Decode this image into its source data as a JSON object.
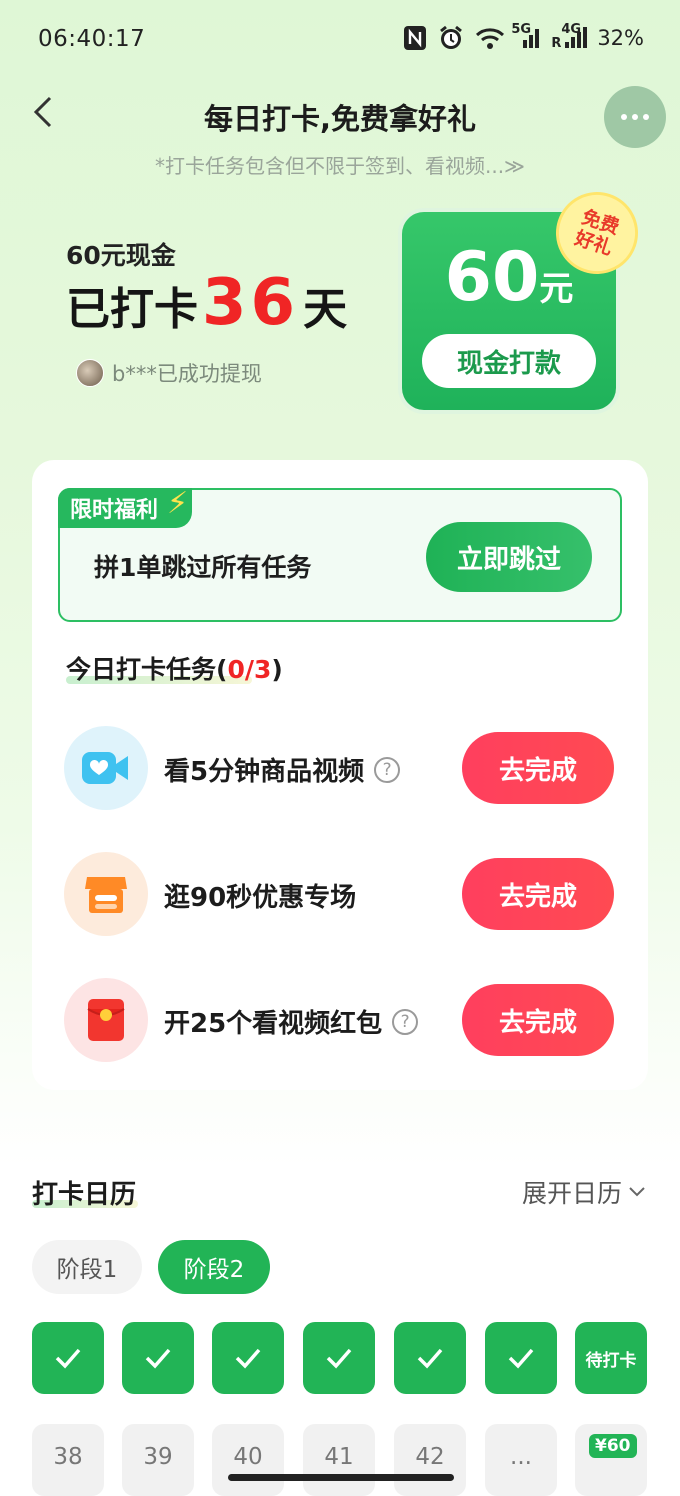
{
  "status_bar": {
    "time": "06:40:17",
    "network_5g": "5G",
    "network_4g": "4G",
    "roaming": "R",
    "battery": "32%"
  },
  "header": {
    "title": "每日打卡,免费拿好礼",
    "subtitle": "*打卡任务包含但不限于签到、看视频...≫"
  },
  "hero": {
    "reward_line": "60元现金",
    "checked_prefix": "已打卡",
    "checked_days": "36",
    "checked_suffix": "天",
    "user_text": "b***已成功提现"
  },
  "reward_card": {
    "amount": "60",
    "unit": "元",
    "button_label": "现金打款",
    "badge": "免费好礼"
  },
  "promo": {
    "tag": "限时福利",
    "text": "拼1单跳过所有任务",
    "button_label": "立即跳过"
  },
  "tasks": {
    "heading": "今日打卡任务(",
    "count": "0/3",
    "heading_close": ")",
    "items": [
      {
        "label": "看5分钟商品视频",
        "button": "去完成",
        "has_help": true,
        "icon": "video-camera-icon"
      },
      {
        "label": "逛90秒优惠专场",
        "button": "去完成",
        "has_help": false,
        "icon": "shop-icon"
      },
      {
        "label": "开25个看视频红包",
        "button": "去完成",
        "has_help": true,
        "icon": "red-envelope-icon"
      }
    ]
  },
  "calendar": {
    "title": "打卡日历",
    "expand_label": "展开日历",
    "stages": [
      "阶段1",
      "阶段2"
    ],
    "active_stage": "阶段2",
    "row1": [
      "✓",
      "✓",
      "✓",
      "✓",
      "✓",
      "✓",
      "待打卡"
    ],
    "row2": [
      "38",
      "39",
      "40",
      "41",
      "42",
      "...",
      ""
    ],
    "prize_label": "¥60"
  },
  "colors": {
    "brand_green": "#22b456",
    "accent_red": "#f02525",
    "task_button": "#ff4259"
  }
}
